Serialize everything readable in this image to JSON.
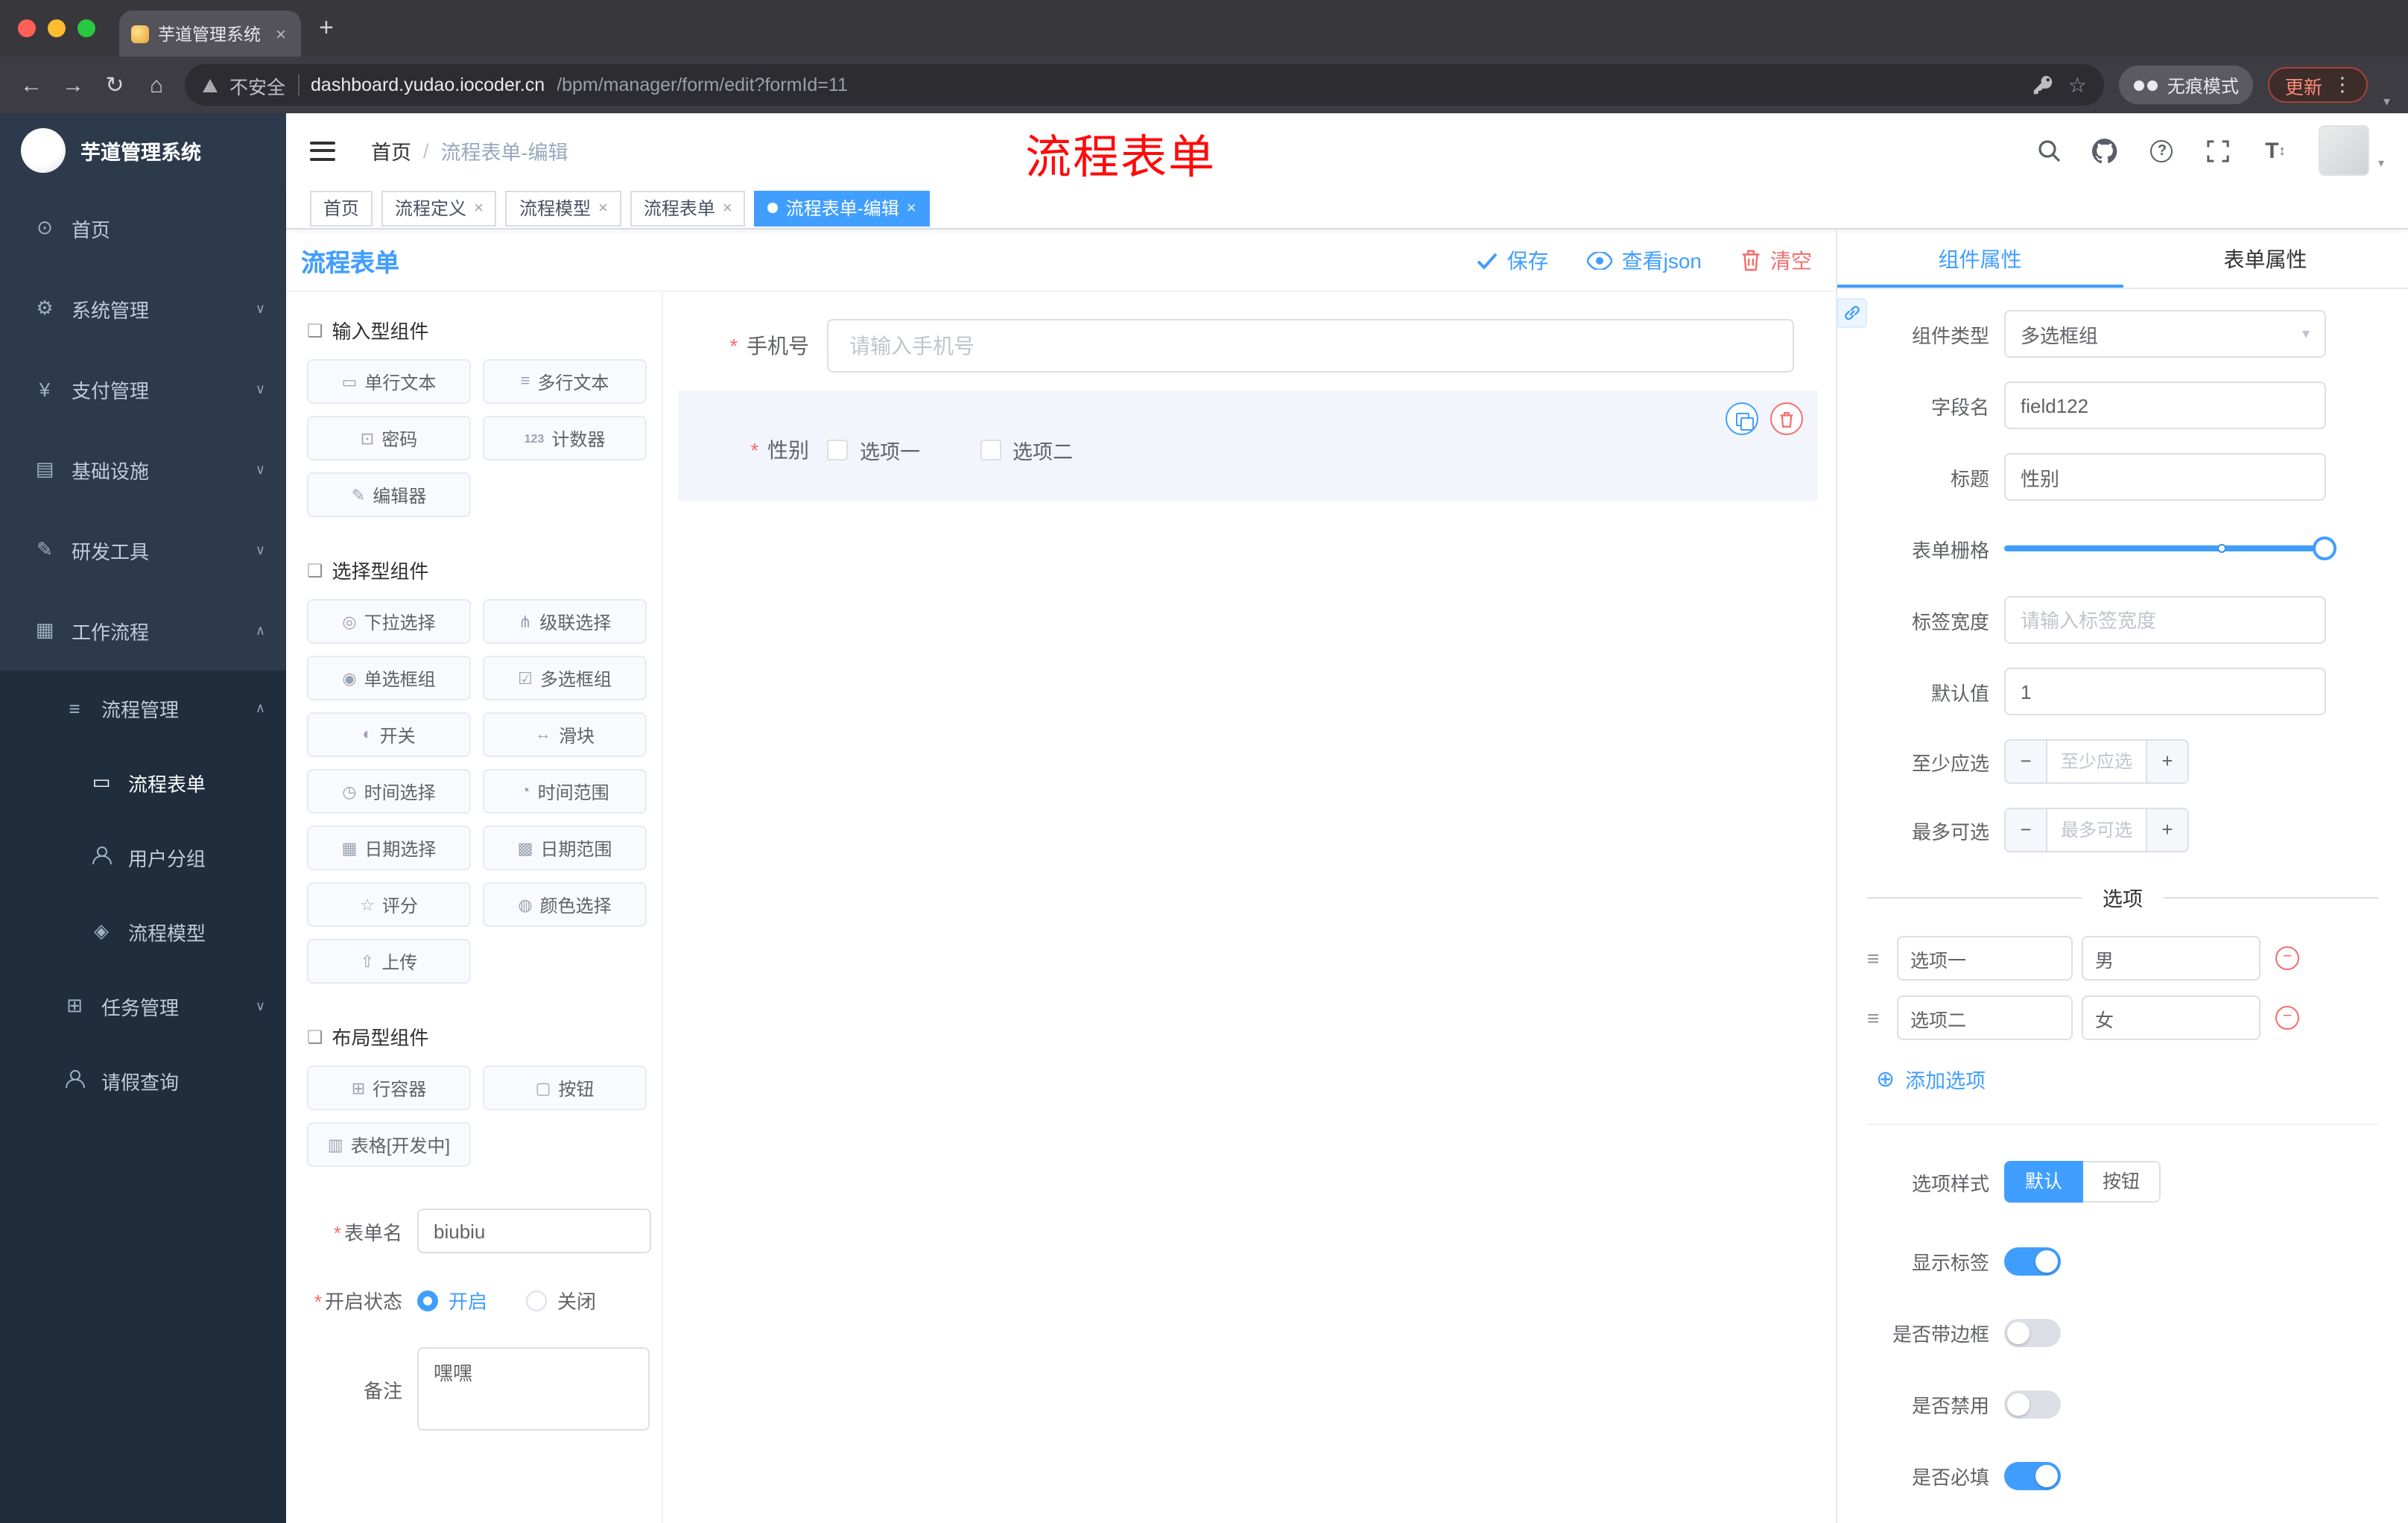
{
  "colors": {
    "primary": "#409eff",
    "danger": "#f56c6c",
    "annotation_red": "#fe0b0b",
    "sidebar_bg": "#2d3a4b",
    "submenu_bg": "#1f2d3d"
  },
  "browser": {
    "tab_title": "芋道管理系统",
    "address": {
      "security_label": "不安全",
      "domain": "dashboard.yudao.iocoder.cn",
      "path": "/bpm/manager/form/edit?formId=11"
    },
    "incognito_label": "无痕模式",
    "update_label": "更新"
  },
  "sidebar": {
    "title": "芋道管理系统",
    "items": [
      {
        "label": "首页"
      },
      {
        "label": "系统管理"
      },
      {
        "label": "支付管理"
      },
      {
        "label": "基础设施"
      },
      {
        "label": "研发工具"
      },
      {
        "label": "工作流程"
      },
      {
        "label": "流程管理"
      },
      {
        "label": "流程表单"
      },
      {
        "label": "用户分组"
      },
      {
        "label": "流程模型"
      },
      {
        "label": "任务管理"
      },
      {
        "label": "请假查询"
      }
    ]
  },
  "header": {
    "breadcrumb": {
      "root": "首页",
      "current": "流程表单-编辑"
    },
    "annotation": "流程表单"
  },
  "tags": [
    {
      "label": "首页"
    },
    {
      "label": "流程定义"
    },
    {
      "label": "流程模型"
    },
    {
      "label": "流程表单"
    },
    {
      "label": "流程表单-编辑"
    }
  ],
  "designer": {
    "panel_title": "流程表单",
    "actions": {
      "save": "保存",
      "view_json": "查看json",
      "clear": "清空"
    },
    "palette": {
      "sections": [
        {
          "title": "输入型组件",
          "items": [
            {
              "label": "单行文本"
            },
            {
              "label": "多行文本"
            },
            {
              "label": "密码"
            },
            {
              "label": "计数器"
            },
            {
              "label": "编辑器"
            }
          ]
        },
        {
          "title": "选择型组件",
          "items": [
            {
              "label": "下拉选择"
            },
            {
              "label": "级联选择"
            },
            {
              "label": "单选框组"
            },
            {
              "label": "多选框组"
            },
            {
              "label": "开关"
            },
            {
              "label": "滑块"
            },
            {
              "label": "时间选择"
            },
            {
              "label": "时间范围"
            },
            {
              "label": "日期选择"
            },
            {
              "label": "日期范围"
            },
            {
              "label": "评分"
            },
            {
              "label": "颜色选择"
            },
            {
              "label": "上传"
            }
          ]
        },
        {
          "title": "布局型组件",
          "items": [
            {
              "label": "行容器"
            },
            {
              "label": "按钮"
            },
            {
              "label": "表格[开发中]"
            }
          ]
        }
      ]
    },
    "meta": {
      "name_label": "表单名",
      "name_value": "biubiu",
      "status_label": "开启状态",
      "status_on": "开启",
      "status_off": "关闭",
      "remark_label": "备注",
      "remark_value": "嘿嘿"
    },
    "canvas": {
      "phone": {
        "label": "手机号",
        "placeholder": "请输入手机号"
      },
      "gender": {
        "label": "性别",
        "options": [
          "选项一",
          "选项二"
        ]
      }
    }
  },
  "inspector": {
    "tabs": {
      "component": "组件属性",
      "form": "表单属性"
    },
    "component_type": {
      "label": "组件类型",
      "value": "多选框组"
    },
    "field_name": {
      "label": "字段名",
      "value": "field122"
    },
    "title_row": {
      "label": "标题",
      "value": "性别"
    },
    "grid": {
      "label": "表单栅格"
    },
    "label_width": {
      "label": "标签宽度",
      "placeholder": "请输入标签宽度"
    },
    "default_value": {
      "label": "默认值",
      "value": "1"
    },
    "min_select": {
      "label": "至少应选",
      "placeholder": "至少应选"
    },
    "max_select": {
      "label": "最多可选",
      "placeholder": "最多可选"
    },
    "options_title": "选项",
    "options": [
      {
        "label": "选项一",
        "value": "男"
      },
      {
        "label": "选项二",
        "value": "女"
      }
    ],
    "add_option": "添加选项",
    "option_style": {
      "label": "选项样式",
      "default": "默认",
      "button": "按钮"
    },
    "switches": [
      {
        "label": "显示标签",
        "on": true
      },
      {
        "label": "是否带边框",
        "on": false
      },
      {
        "label": "是否禁用",
        "on": false
      },
      {
        "label": "是否必填",
        "on": true
      }
    ]
  }
}
